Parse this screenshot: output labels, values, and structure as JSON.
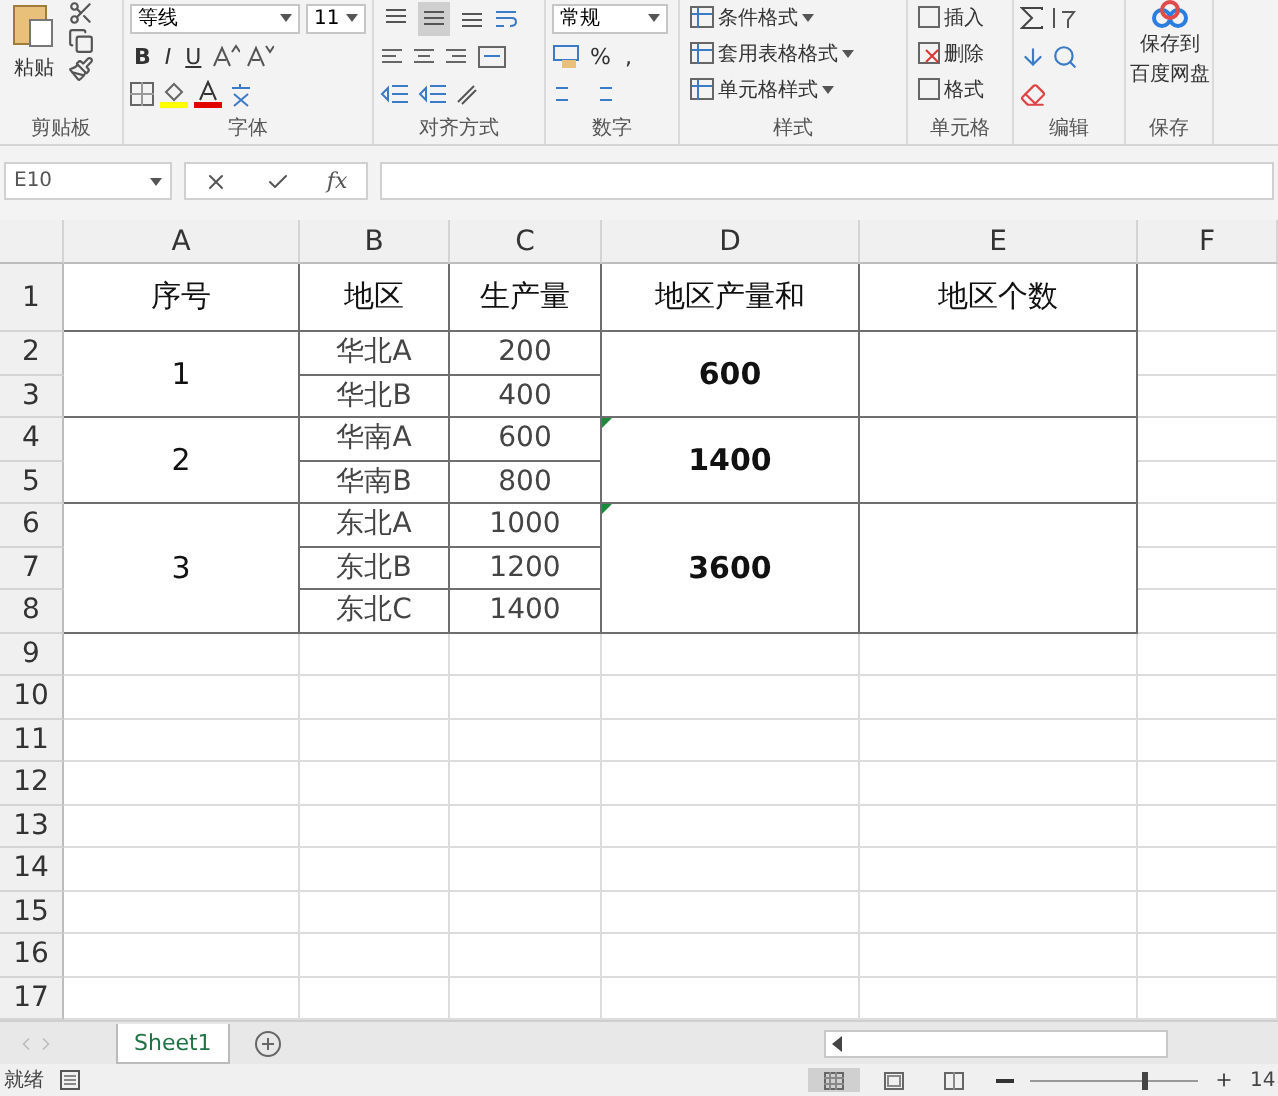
{
  "ribbon": {
    "clipboard": {
      "label": "剪贴板",
      "paste": "粘贴"
    },
    "font": {
      "label": "字体",
      "font_name": "等线",
      "font_size": "11",
      "style_buttons": [
        "B",
        "I",
        "U"
      ]
    },
    "alignment": {
      "label": "对齐方式",
      "vertical_align_buttons": [
        {
          "selected": false
        },
        {
          "selected": true
        },
        {
          "selected": false
        }
      ]
    },
    "number": {
      "label": "数字",
      "format": "常规",
      "buttons": [
        "%",
        ","
      ]
    },
    "styles": {
      "label": "样式",
      "items": [
        "条件格式",
        "套用表格格式",
        "单元格样式"
      ]
    },
    "cells": {
      "label": "单元格",
      "items": [
        "插入",
        "删除",
        "格式"
      ]
    },
    "editing": {
      "label": "编辑"
    },
    "save": {
      "label": "保存",
      "button_lines": [
        "保存到",
        "百度网盘"
      ]
    }
  },
  "formula_bar": {
    "name_box": "E10",
    "function_button": "fx"
  },
  "sheet": {
    "columns": [
      "A",
      "B",
      "C",
      "D",
      "E",
      "F"
    ],
    "row_numbers": [
      "1",
      "2",
      "3",
      "4",
      "5",
      "6",
      "7",
      "8",
      "9",
      "10",
      "11",
      "12",
      "13",
      "14",
      "15",
      "16",
      "17"
    ],
    "header": [
      "序号",
      "地区",
      "生产量",
      "地区产量和",
      "地区个数"
    ],
    "groups": [
      {
        "index": "1",
        "total": "600",
        "error_flag": false,
        "items": [
          {
            "region": "华北A",
            "amount": "200"
          },
          {
            "region": "华北B",
            "amount": "400"
          }
        ]
      },
      {
        "index": "2",
        "total": "1400",
        "error_flag": true,
        "items": [
          {
            "region": "华南A",
            "amount": "600"
          },
          {
            "region": "华南B",
            "amount": "800"
          }
        ]
      },
      {
        "index": "3",
        "total": "3600",
        "error_flag": true,
        "items": [
          {
            "region": "东北A",
            "amount": "1000"
          },
          {
            "region": "东北B",
            "amount": "1200"
          },
          {
            "region": "东北C",
            "amount": "1400"
          }
        ]
      }
    ]
  },
  "sheet_tabs": [
    {
      "label": "Sheet1",
      "selected": true
    }
  ],
  "status_bar": {
    "status": "就绪",
    "views": [
      {
        "selected": true
      },
      {
        "selected": false
      },
      {
        "selected": false
      }
    ],
    "zoom_slider": {
      "level": 0.68
    },
    "zoom": "14"
  }
}
